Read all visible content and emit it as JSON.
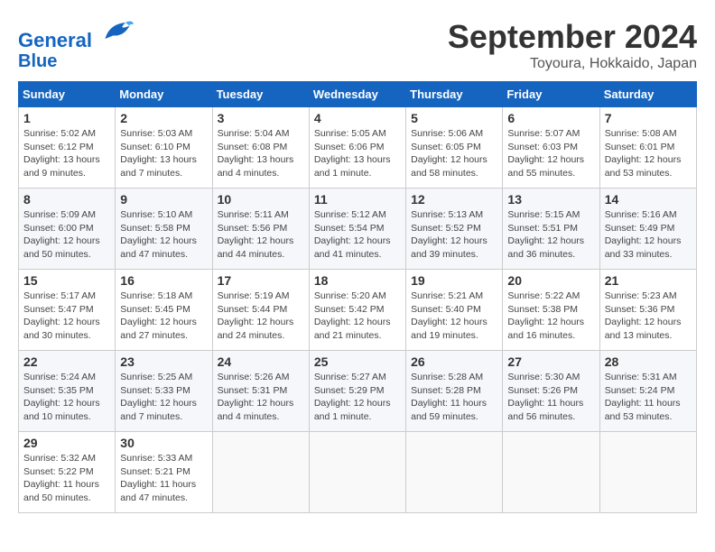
{
  "header": {
    "logo_line1": "General",
    "logo_line2": "Blue",
    "month_title": "September 2024",
    "subtitle": "Toyoura, Hokkaido, Japan"
  },
  "weekdays": [
    "Sunday",
    "Monday",
    "Tuesday",
    "Wednesday",
    "Thursday",
    "Friday",
    "Saturday"
  ],
  "weeks": [
    [
      {
        "day": "1",
        "info": "Sunrise: 5:02 AM\nSunset: 6:12 PM\nDaylight: 13 hours and 9 minutes."
      },
      {
        "day": "2",
        "info": "Sunrise: 5:03 AM\nSunset: 6:10 PM\nDaylight: 13 hours and 7 minutes."
      },
      {
        "day": "3",
        "info": "Sunrise: 5:04 AM\nSunset: 6:08 PM\nDaylight: 13 hours and 4 minutes."
      },
      {
        "day": "4",
        "info": "Sunrise: 5:05 AM\nSunset: 6:06 PM\nDaylight: 13 hours and 1 minute."
      },
      {
        "day": "5",
        "info": "Sunrise: 5:06 AM\nSunset: 6:05 PM\nDaylight: 12 hours and 58 minutes."
      },
      {
        "day": "6",
        "info": "Sunrise: 5:07 AM\nSunset: 6:03 PM\nDaylight: 12 hours and 55 minutes."
      },
      {
        "day": "7",
        "info": "Sunrise: 5:08 AM\nSunset: 6:01 PM\nDaylight: 12 hours and 53 minutes."
      }
    ],
    [
      {
        "day": "8",
        "info": "Sunrise: 5:09 AM\nSunset: 6:00 PM\nDaylight: 12 hours and 50 minutes."
      },
      {
        "day": "9",
        "info": "Sunrise: 5:10 AM\nSunset: 5:58 PM\nDaylight: 12 hours and 47 minutes."
      },
      {
        "day": "10",
        "info": "Sunrise: 5:11 AM\nSunset: 5:56 PM\nDaylight: 12 hours and 44 minutes."
      },
      {
        "day": "11",
        "info": "Sunrise: 5:12 AM\nSunset: 5:54 PM\nDaylight: 12 hours and 41 minutes."
      },
      {
        "day": "12",
        "info": "Sunrise: 5:13 AM\nSunset: 5:52 PM\nDaylight: 12 hours and 39 minutes."
      },
      {
        "day": "13",
        "info": "Sunrise: 5:15 AM\nSunset: 5:51 PM\nDaylight: 12 hours and 36 minutes."
      },
      {
        "day": "14",
        "info": "Sunrise: 5:16 AM\nSunset: 5:49 PM\nDaylight: 12 hours and 33 minutes."
      }
    ],
    [
      {
        "day": "15",
        "info": "Sunrise: 5:17 AM\nSunset: 5:47 PM\nDaylight: 12 hours and 30 minutes."
      },
      {
        "day": "16",
        "info": "Sunrise: 5:18 AM\nSunset: 5:45 PM\nDaylight: 12 hours and 27 minutes."
      },
      {
        "day": "17",
        "info": "Sunrise: 5:19 AM\nSunset: 5:44 PM\nDaylight: 12 hours and 24 minutes."
      },
      {
        "day": "18",
        "info": "Sunrise: 5:20 AM\nSunset: 5:42 PM\nDaylight: 12 hours and 21 minutes."
      },
      {
        "day": "19",
        "info": "Sunrise: 5:21 AM\nSunset: 5:40 PM\nDaylight: 12 hours and 19 minutes."
      },
      {
        "day": "20",
        "info": "Sunrise: 5:22 AM\nSunset: 5:38 PM\nDaylight: 12 hours and 16 minutes."
      },
      {
        "day": "21",
        "info": "Sunrise: 5:23 AM\nSunset: 5:36 PM\nDaylight: 12 hours and 13 minutes."
      }
    ],
    [
      {
        "day": "22",
        "info": "Sunrise: 5:24 AM\nSunset: 5:35 PM\nDaylight: 12 hours and 10 minutes."
      },
      {
        "day": "23",
        "info": "Sunrise: 5:25 AM\nSunset: 5:33 PM\nDaylight: 12 hours and 7 minutes."
      },
      {
        "day": "24",
        "info": "Sunrise: 5:26 AM\nSunset: 5:31 PM\nDaylight: 12 hours and 4 minutes."
      },
      {
        "day": "25",
        "info": "Sunrise: 5:27 AM\nSunset: 5:29 PM\nDaylight: 12 hours and 1 minute."
      },
      {
        "day": "26",
        "info": "Sunrise: 5:28 AM\nSunset: 5:28 PM\nDaylight: 11 hours and 59 minutes."
      },
      {
        "day": "27",
        "info": "Sunrise: 5:30 AM\nSunset: 5:26 PM\nDaylight: 11 hours and 56 minutes."
      },
      {
        "day": "28",
        "info": "Sunrise: 5:31 AM\nSunset: 5:24 PM\nDaylight: 11 hours and 53 minutes."
      }
    ],
    [
      {
        "day": "29",
        "info": "Sunrise: 5:32 AM\nSunset: 5:22 PM\nDaylight: 11 hours and 50 minutes."
      },
      {
        "day": "30",
        "info": "Sunrise: 5:33 AM\nSunset: 5:21 PM\nDaylight: 11 hours and 47 minutes."
      },
      {
        "day": "",
        "info": ""
      },
      {
        "day": "",
        "info": ""
      },
      {
        "day": "",
        "info": ""
      },
      {
        "day": "",
        "info": ""
      },
      {
        "day": "",
        "info": ""
      }
    ]
  ]
}
